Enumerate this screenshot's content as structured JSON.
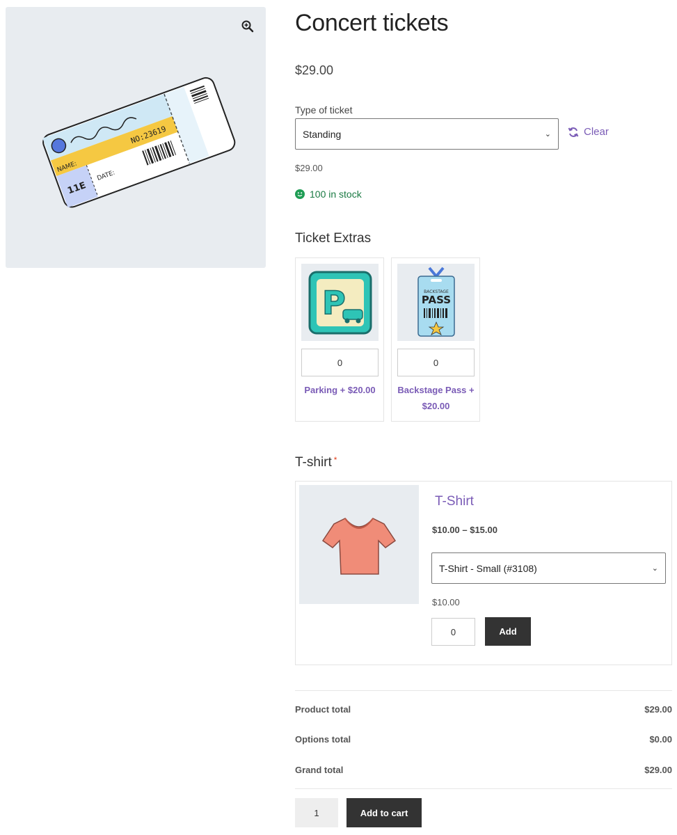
{
  "product": {
    "title": "Concert tickets",
    "price": "$29.00"
  },
  "variation": {
    "label": "Type of ticket",
    "selected": "Standing",
    "clear_label": "Clear",
    "price": "$29.00",
    "stock": "100 in stock"
  },
  "extras": {
    "title": "Ticket Extras",
    "items": [
      {
        "name": "Parking + $20.00",
        "qty": "0",
        "icon": "parking-sign-icon",
        "image_text": "P"
      },
      {
        "name": "Backstage Pass + $20.00",
        "qty": "0",
        "icon": "backstage-pass-icon",
        "image_text": "BACKSTAGE PASS"
      }
    ]
  },
  "tshirt": {
    "section_title": "T-shirt",
    "required_mark": "*",
    "name": "T-Shirt",
    "range": "$10.00 – $15.00",
    "selected": "T-Shirt - Small (#3108)",
    "price": "$10.00",
    "qty": "0",
    "add_label": "Add"
  },
  "totals": {
    "rows": [
      {
        "label": "Product total",
        "value": "$29.00"
      },
      {
        "label": "Options total",
        "value": "$0.00"
      },
      {
        "label": "Grand total",
        "value": "$29.00"
      }
    ]
  },
  "cart": {
    "qty": "1",
    "button_label": "Add to cart"
  },
  "colors": {
    "accent": "#7a5bb6",
    "stock_green": "#1a7a43",
    "button_dark": "#333333",
    "required_red": "#e2401c"
  }
}
